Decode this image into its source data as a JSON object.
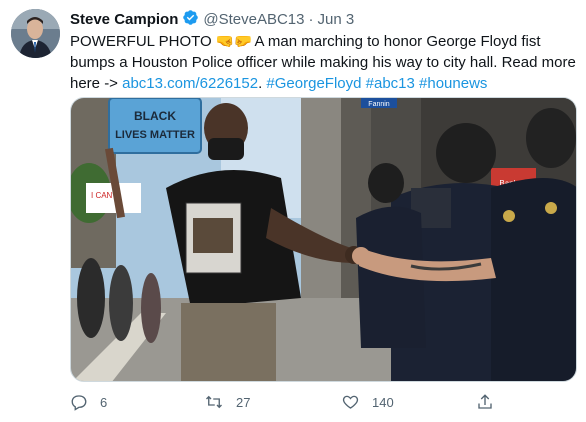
{
  "tweet": {
    "author_name": "Steve Campion",
    "handle": "@SteveABC13",
    "separator": "·",
    "date": "Jun 3",
    "text_prefix": "POWERFUL PHOTO ",
    "emoji": "🤜🤛",
    "text_main": " A man marching to honor George Floyd fist bumps a Houston Police officer while making his way to city hall. Read more here -> ",
    "link": "abc13.com/6226152",
    "link_suffix": ".",
    "hashtags": [
      "#GeorgeFloyd",
      "#abc13",
      "#hounews"
    ]
  },
  "photo": {
    "sign_text_line1": "BLACK",
    "sign_text_line2": "LIVES MATTER",
    "street_sign": "Fannin",
    "store_sign": "Bank of"
  },
  "actions": {
    "replies": "6",
    "retweets": "27",
    "likes": "140"
  },
  "colors": {
    "link": "#1b95e0",
    "verified": "#1d9bf0",
    "muted": "#536471"
  }
}
